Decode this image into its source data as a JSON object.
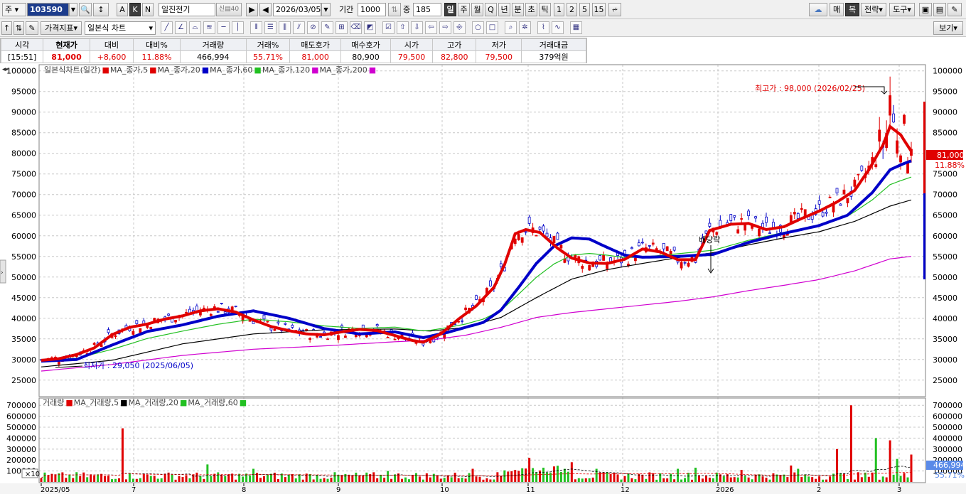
{
  "toolbar": {
    "market_label": "주",
    "code": "103590",
    "type_a": "A",
    "type_k": "K",
    "type_n": "N",
    "stock_name": "일진전기",
    "date": "2026/03/05",
    "period_label": "기간",
    "period_value": "1000",
    "count_label": "중",
    "count_value": "185",
    "periods": [
      "일",
      "주",
      "월",
      "Q",
      "년",
      "분",
      "초",
      "틱",
      "1",
      "2",
      "5",
      "15"
    ],
    "right_buttons": [
      "매",
      "복",
      "전략",
      "도구"
    ],
    "view_button": "보기"
  },
  "toolbar2": {
    "indicator_button": "가격지표",
    "chart_type": "일본식 차트"
  },
  "quote": {
    "headers": [
      "시각",
      "현재가",
      "대비",
      "대비%",
      "거래량",
      "거래%",
      "매도호가",
      "매수호가",
      "시가",
      "고가",
      "저가",
      "거래대금"
    ],
    "values": [
      "[15:51]",
      "81,000",
      "+8,600",
      "11.88%",
      "466,994",
      "55.71%",
      "81,000",
      "80,900",
      "79,500",
      "82,800",
      "79,500",
      "379억원"
    ]
  },
  "legend": {
    "title": "일본식차트(일간)",
    "items": [
      {
        "label": "MA_종가,5",
        "color": "#e00000"
      },
      {
        "label": "MA_종가,20",
        "color": "#e00000"
      },
      {
        "label": "MA_종가,60",
        "color": "#0000c8"
      },
      {
        "label": "MA_종가,120",
        "color": "#22c022"
      },
      {
        "label": "MA_종가,200",
        "color": "#d000d0"
      }
    ]
  },
  "volume_legend": {
    "title": "거래량",
    "items": [
      {
        "label": "MA_거래량,5",
        "color": "#e00000"
      },
      {
        "label": "MA_거래량,20",
        "color": "#000000"
      },
      {
        "label": "MA_거래량,60",
        "color": "#22c022"
      }
    ]
  },
  "annotations": {
    "high": "최고가 : 98,000 (2026/02/25)",
    "low": "최저가 : 29,050 (2025/06/05)",
    "dividend": "배당락",
    "current_price": "81,000",
    "current_pct": "11.88%",
    "volume_value": "466,994",
    "volume_pct": "55.71%",
    "volume_scale": "×10"
  },
  "colors": {
    "up": "#e00000",
    "down": "#0000c8",
    "ma120": "#22c022",
    "ma200": "#d000d0"
  },
  "chart_data": {
    "type": "candlestick",
    "title": "일본식차트(일간)",
    "y_ticks": [
      25000,
      30000,
      35000,
      40000,
      45000,
      50000,
      55000,
      60000,
      65000,
      70000,
      75000,
      80000,
      85000,
      90000,
      95000,
      100000
    ],
    "ylim": [
      21000,
      101500
    ],
    "x_ticks": [
      "2025/05",
      "7",
      "8",
      "9",
      "10",
      "11",
      "12",
      "2026",
      "2",
      "3"
    ],
    "ma_close": {
      "ma20": [
        [
          0,
          29800
        ],
        [
          5,
          30200
        ],
        [
          10,
          31200
        ],
        [
          15,
          32800
        ],
        [
          20,
          36000
        ],
        [
          25,
          37800
        ],
        [
          30,
          38600
        ],
        [
          35,
          39800
        ],
        [
          40,
          40600
        ],
        [
          45,
          41800
        ],
        [
          50,
          42300
        ],
        [
          55,
          41500
        ],
        [
          60,
          39600
        ],
        [
          65,
          38000
        ],
        [
          70,
          37000
        ],
        [
          75,
          36200
        ],
        [
          80,
          36000
        ],
        [
          85,
          36700
        ],
        [
          90,
          37300
        ],
        [
          95,
          37000
        ],
        [
          100,
          35800
        ],
        [
          105,
          34600
        ],
        [
          108,
          34200
        ],
        [
          113,
          36200
        ],
        [
          118,
          39800
        ],
        [
          123,
          43000
        ],
        [
          128,
          47500
        ],
        [
          131,
          53000
        ],
        [
          134,
          60500
        ],
        [
          137,
          61500
        ],
        [
          141,
          60800
        ],
        [
          146,
          57000
        ],
        [
          150,
          54600
        ],
        [
          155,
          53400
        ],
        [
          160,
          53300
        ],
        [
          165,
          54300
        ],
        [
          170,
          56800
        ],
        [
          175,
          56100
        ],
        [
          180,
          54200
        ],
        [
          185,
          54200
        ],
        [
          189,
          61300
        ],
        [
          195,
          62800
        ],
        [
          200,
          63000
        ],
        [
          205,
          61500
        ],
        [
          210,
          62200
        ],
        [
          215,
          64200
        ],
        [
          220,
          66000
        ],
        [
          225,
          68200
        ],
        [
          230,
          71000
        ],
        [
          234,
          76000
        ],
        [
          238,
          82000
        ],
        [
          240,
          86500
        ],
        [
          243,
          84500
        ],
        [
          246,
          80500
        ]
      ],
      "ma60": [
        [
          0,
          29600
        ],
        [
          10,
          30000
        ],
        [
          20,
          33500
        ],
        [
          30,
          36800
        ],
        [
          40,
          38400
        ],
        [
          50,
          40500
        ],
        [
          60,
          41800
        ],
        [
          70,
          40000
        ],
        [
          80,
          37500
        ],
        [
          90,
          36200
        ],
        [
          100,
          36700
        ],
        [
          108,
          35300
        ],
        [
          115,
          36600
        ],
        [
          125,
          39000
        ],
        [
          130,
          42000
        ],
        [
          135,
          47500
        ],
        [
          140,
          53300
        ],
        [
          145,
          57500
        ],
        [
          150,
          59500
        ],
        [
          155,
          59200
        ],
        [
          160,
          57200
        ],
        [
          165,
          55300
        ],
        [
          170,
          54800
        ],
        [
          180,
          55000
        ],
        [
          190,
          55500
        ],
        [
          200,
          58400
        ],
        [
          210,
          60600
        ],
        [
          220,
          62500
        ],
        [
          228,
          65000
        ],
        [
          235,
          70500
        ],
        [
          240,
          76000
        ],
        [
          243,
          77200
        ],
        [
          246,
          78200
        ]
      ],
      "ma120": [
        [
          0,
          28200
        ],
        [
          20,
          29800
        ],
        [
          40,
          33800
        ],
        [
          60,
          36200
        ],
        [
          80,
          37200
        ],
        [
          100,
          37400
        ],
        [
          110,
          36900
        ],
        [
          120,
          37800
        ],
        [
          130,
          40200
        ],
        [
          140,
          45000
        ],
        [
          150,
          49500
        ],
        [
          160,
          51800
        ],
        [
          170,
          53300
        ],
        [
          180,
          54700
        ],
        [
          190,
          55900
        ],
        [
          200,
          57800
        ],
        [
          210,
          59500
        ],
        [
          220,
          61000
        ],
        [
          230,
          63500
        ],
        [
          240,
          67200
        ],
        [
          246,
          68700
        ]
      ],
      "ma200": [
        [
          0,
          27200
        ],
        [
          20,
          28800
        ],
        [
          40,
          31000
        ],
        [
          60,
          32500
        ],
        [
          80,
          33300
        ],
        [
          100,
          34300
        ],
        [
          110,
          34700
        ],
        [
          120,
          35900
        ],
        [
          130,
          37800
        ],
        [
          140,
          40200
        ],
        [
          150,
          41400
        ],
        [
          160,
          42300
        ],
        [
          170,
          43200
        ],
        [
          180,
          44100
        ],
        [
          190,
          45200
        ],
        [
          200,
          46700
        ],
        [
          210,
          48000
        ],
        [
          220,
          49400
        ],
        [
          230,
          51500
        ],
        [
          240,
          54400
        ],
        [
          246,
          55000
        ]
      ]
    },
    "volume_ticks": [
      100000,
      200000,
      300000,
      400000,
      500000,
      600000,
      700000
    ],
    "volume_ylim": [
      0,
      760000
    ],
    "volume_spikes": [
      [
        23,
        490000
      ],
      [
        47,
        160000
      ],
      [
        60,
        120000
      ],
      [
        98,
        100000
      ],
      [
        122,
        120000
      ],
      [
        138,
        220000
      ],
      [
        150,
        180000
      ],
      [
        157,
        120000
      ],
      [
        180,
        120000
      ],
      [
        185,
        130000
      ],
      [
        198,
        110000
      ],
      [
        212,
        150000
      ],
      [
        214,
        120000
      ],
      [
        225,
        300000
      ],
      [
        229,
        700000
      ],
      [
        236,
        400000
      ],
      [
        240,
        380000
      ],
      [
        242,
        210000
      ],
      [
        246,
        250000
      ]
    ]
  }
}
